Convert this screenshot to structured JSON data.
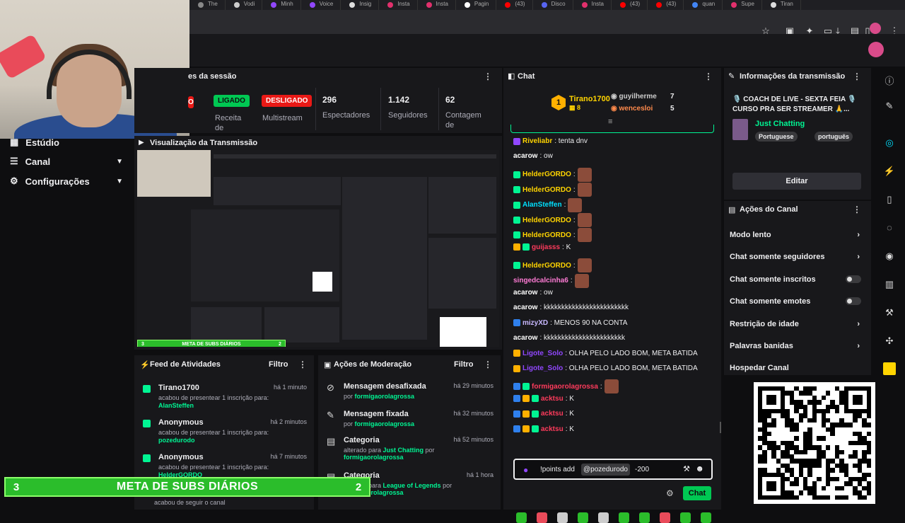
{
  "browser": {
    "tabs": [
      {
        "label": "The",
        "color": "#888888"
      },
      {
        "label": "Vodi",
        "color": "#cccccc"
      },
      {
        "label": "Minh",
        "color": "#9147ff"
      },
      {
        "label": "Voice",
        "color": "#9147ff"
      },
      {
        "label": "Insig",
        "color": "#dddddd"
      },
      {
        "label": "Insta",
        "color": "#e1306c"
      },
      {
        "label": "Insta",
        "color": "#e1306c"
      },
      {
        "label": "Pagin",
        "color": "#ffffff"
      },
      {
        "label": "(43)",
        "color": "#ff0000"
      },
      {
        "label": "Disco",
        "color": "#5865f2"
      },
      {
        "label": "Insta",
        "color": "#e1306c"
      },
      {
        "label": "(43)",
        "color": "#ff0000"
      },
      {
        "label": "(43)",
        "color": "#ff0000"
      },
      {
        "label": "quan",
        "color": "#4285f4"
      },
      {
        "label": "Supe",
        "color": "#e1306c"
      },
      {
        "label": "Tiran",
        "color": "#dddddd"
      }
    ]
  },
  "nav": {
    "studio": "Estúdio",
    "channel": "Canal",
    "settings": "Configurações"
  },
  "stats": {
    "title": "es da sessão",
    "live_pill": "LIGADO",
    "live_label": "Receita de",
    "multistream_pill": "DESLIGADO",
    "multistream_label": "Multistream",
    "viewers_num": "296",
    "viewers_label": "Espectadores",
    "followers_num": "1.142",
    "followers_label": "Seguidores",
    "count_num": "62",
    "count_label": "Contagem de",
    "partial_pill": "O"
  },
  "preview": {
    "title": "Visualização da Transmissão",
    "mini_subs_left": "3",
    "mini_subs_text": "META DE SUBS DIÁRIOS",
    "mini_subs_right": "2"
  },
  "feed": {
    "title": "Feed de Atividades",
    "filter": "Filtro",
    "items": [
      {
        "name": "Tirano1700",
        "time": "há 1 minuto",
        "desc": "acabou de presentear 1 inscrição para:",
        "user": "AlanSteffen"
      },
      {
        "name": "Anonymous",
        "time": "há 2 minutos",
        "desc": "acabou de presentear 1 inscrição para:",
        "user": "pozedurodo"
      },
      {
        "name": "Anonymous",
        "time": "há 7 minutos",
        "desc": "acabou de presentear 1 inscrição para:",
        "user": "HelderGORDO"
      }
    ],
    "tail": "acabou de seguir o canal"
  },
  "mod": {
    "title": "Ações de Moderação",
    "filter": "Filtro",
    "items": [
      {
        "icon": "⊘",
        "title": "Mensagem desafixada",
        "sub_pre": "por ",
        "sub_user": "formigaorolagrossa",
        "sub_mid": "",
        "sub_user2": "",
        "time": "há 29 minutos"
      },
      {
        "icon": "✎",
        "title": "Mensagem fixada",
        "sub_pre": "por ",
        "sub_user": "formigaorolagrossa",
        "sub_mid": "",
        "sub_user2": "",
        "time": "há 32 minutos"
      },
      {
        "icon": "▤",
        "title": "Categoria",
        "sub_pre": "alterado para ",
        "sub_user": "Just Chatting",
        "sub_mid": " por ",
        "sub_user2": "formigaorolagrossa",
        "time": "há 52 minutos"
      },
      {
        "icon": "▤",
        "title": "Categoria",
        "sub_pre": "alterado para ",
        "sub_user": "League of Legends",
        "sub_mid": " por ",
        "sub_user2": "formigaorolagrossa",
        "time": "há 1 hora"
      }
    ]
  },
  "chat": {
    "title": "Chat",
    "top1_name": "Tirano1700",
    "top1_count": "8",
    "top1_rank": "1",
    "top2_name": "guyilherme",
    "top2_count": "7",
    "top3_name": "wencesloi",
    "top3_count": "5",
    "messages": [
      {
        "user": "Riveliabr",
        "color": "#ffd400",
        "text": ": tenta dnv",
        "badges": [
          "#9147ff"
        ]
      },
      {
        "user": "acarow",
        "color": "#ffffff",
        "text": ": ow",
        "badges": []
      },
      {
        "user": "HelderGORDO",
        "color": "#ffd400",
        "text": ":",
        "badges": [
          "#00f593"
        ],
        "emote": true
      },
      {
        "user": "HelderGORDO",
        "color": "#ffd400",
        "text": ":",
        "badges": [
          "#00f593"
        ],
        "emote": true
      },
      {
        "user": "AlanSteffen",
        "color": "#00e0ff",
        "text": ":",
        "badges": [
          "#00f593"
        ],
        "emote": true
      },
      {
        "user": "HelderGORDO",
        "color": "#ffd400",
        "text": ":",
        "badges": [
          "#00f593"
        ],
        "emote": true
      },
      {
        "user": "HelderGORDO",
        "color": "#ffd400",
        "text": ":",
        "badges": [
          "#00f593"
        ],
        "emote": true
      },
      {
        "user": "guijasss",
        "color": "#ff3b5c",
        "text": ": K",
        "badges": [
          "#ffb000",
          "#00f593"
        ]
      },
      {
        "user": "HelderGORDO",
        "color": "#ffd400",
        "text": ":",
        "badges": [
          "#00f593"
        ],
        "emote": true
      },
      {
        "user": "singedcalcinha6",
        "color": "#ff7bd5",
        "text": ":",
        "badges": [],
        "emote": true
      },
      {
        "user": "acarow",
        "color": "#ffffff",
        "text": ": ow",
        "badges": []
      },
      {
        "user": "acarow",
        "color": "#ffffff",
        "text": ": kkkkkkkkkkkkkkkkkkkkkkkk",
        "badges": []
      },
      {
        "user": "mizyXD",
        "color": "#c8b8ff",
        "text": ": MENOS 90 NA CONTA",
        "badges": [
          "#2f80ed"
        ]
      },
      {
        "user": "acarow",
        "color": "#ffffff",
        "text": ": kkkkkkkkkkkkkkkkkkkkkkk",
        "badges": []
      },
      {
        "user": "Ligote_Solo",
        "color": "#9147ff",
        "text": ": OLHA PELO LADO BOM, META BATIDA",
        "badges": [
          "#ffb000"
        ]
      },
      {
        "user": "Ligote_Solo",
        "color": "#9147ff",
        "text": ": OLHA PELO LADO BOM, META BATIDA",
        "badges": [
          "#ffb000"
        ]
      },
      {
        "user": "formigaorolagrossa",
        "color": "#ff3b5c",
        "text": ":",
        "badges": [
          "#2f80ed",
          "#00f593"
        ],
        "emote": true
      },
      {
        "user": "acktsu",
        "color": "#ff3b5c",
        "text": ": K",
        "badges": [
          "#2f80ed",
          "#ffb000",
          "#00f593"
        ]
      },
      {
        "user": "acktsu",
        "color": "#ff3b5c",
        "text": ": K",
        "badges": [
          "#2f80ed",
          "#ffb000",
          "#00f593"
        ]
      },
      {
        "user": "acktsu",
        "color": "#ff3b5c",
        "text": ": K",
        "badges": [
          "#2f80ed",
          "#ffb000",
          "#00f593"
        ]
      }
    ],
    "input_cmd": "!points add",
    "input_mention": "@pozedurodo",
    "input_amount": "-200",
    "send_button": "Chat"
  },
  "info": {
    "title": "Informações da transmissão",
    "stream_title": "🎙️ COACH DE LIVE - SEXTA FEIA 🎙️ CURSO PRA SER STREAMER 🙏...",
    "category": "Just Chatting",
    "tag1": "Portuguese",
    "tag2": "português",
    "edit_button": "Editar"
  },
  "actions": {
    "title": "Ações do Canal",
    "items": [
      {
        "label": "Modo lento",
        "type": "chevron"
      },
      {
        "label": "Chat somente seguidores",
        "type": "chevron"
      },
      {
        "label": "Chat somente inscritos",
        "type": "toggle"
      },
      {
        "label": "Chat somente emotes",
        "type": "toggle"
      },
      {
        "label": "Restrição de idade",
        "type": "chevron"
      },
      {
        "label": "Palavras banidas",
        "type": "chevron"
      },
      {
        "label": "Hospedar Canal",
        "type": "none"
      }
    ]
  },
  "subs_bar": {
    "left": "3",
    "text": "META DE SUBS DIÁRIOS",
    "right": "2"
  },
  "colors": {
    "accent_green": "#00f593",
    "pill_green": "#00c853",
    "pill_red": "#e91916"
  }
}
